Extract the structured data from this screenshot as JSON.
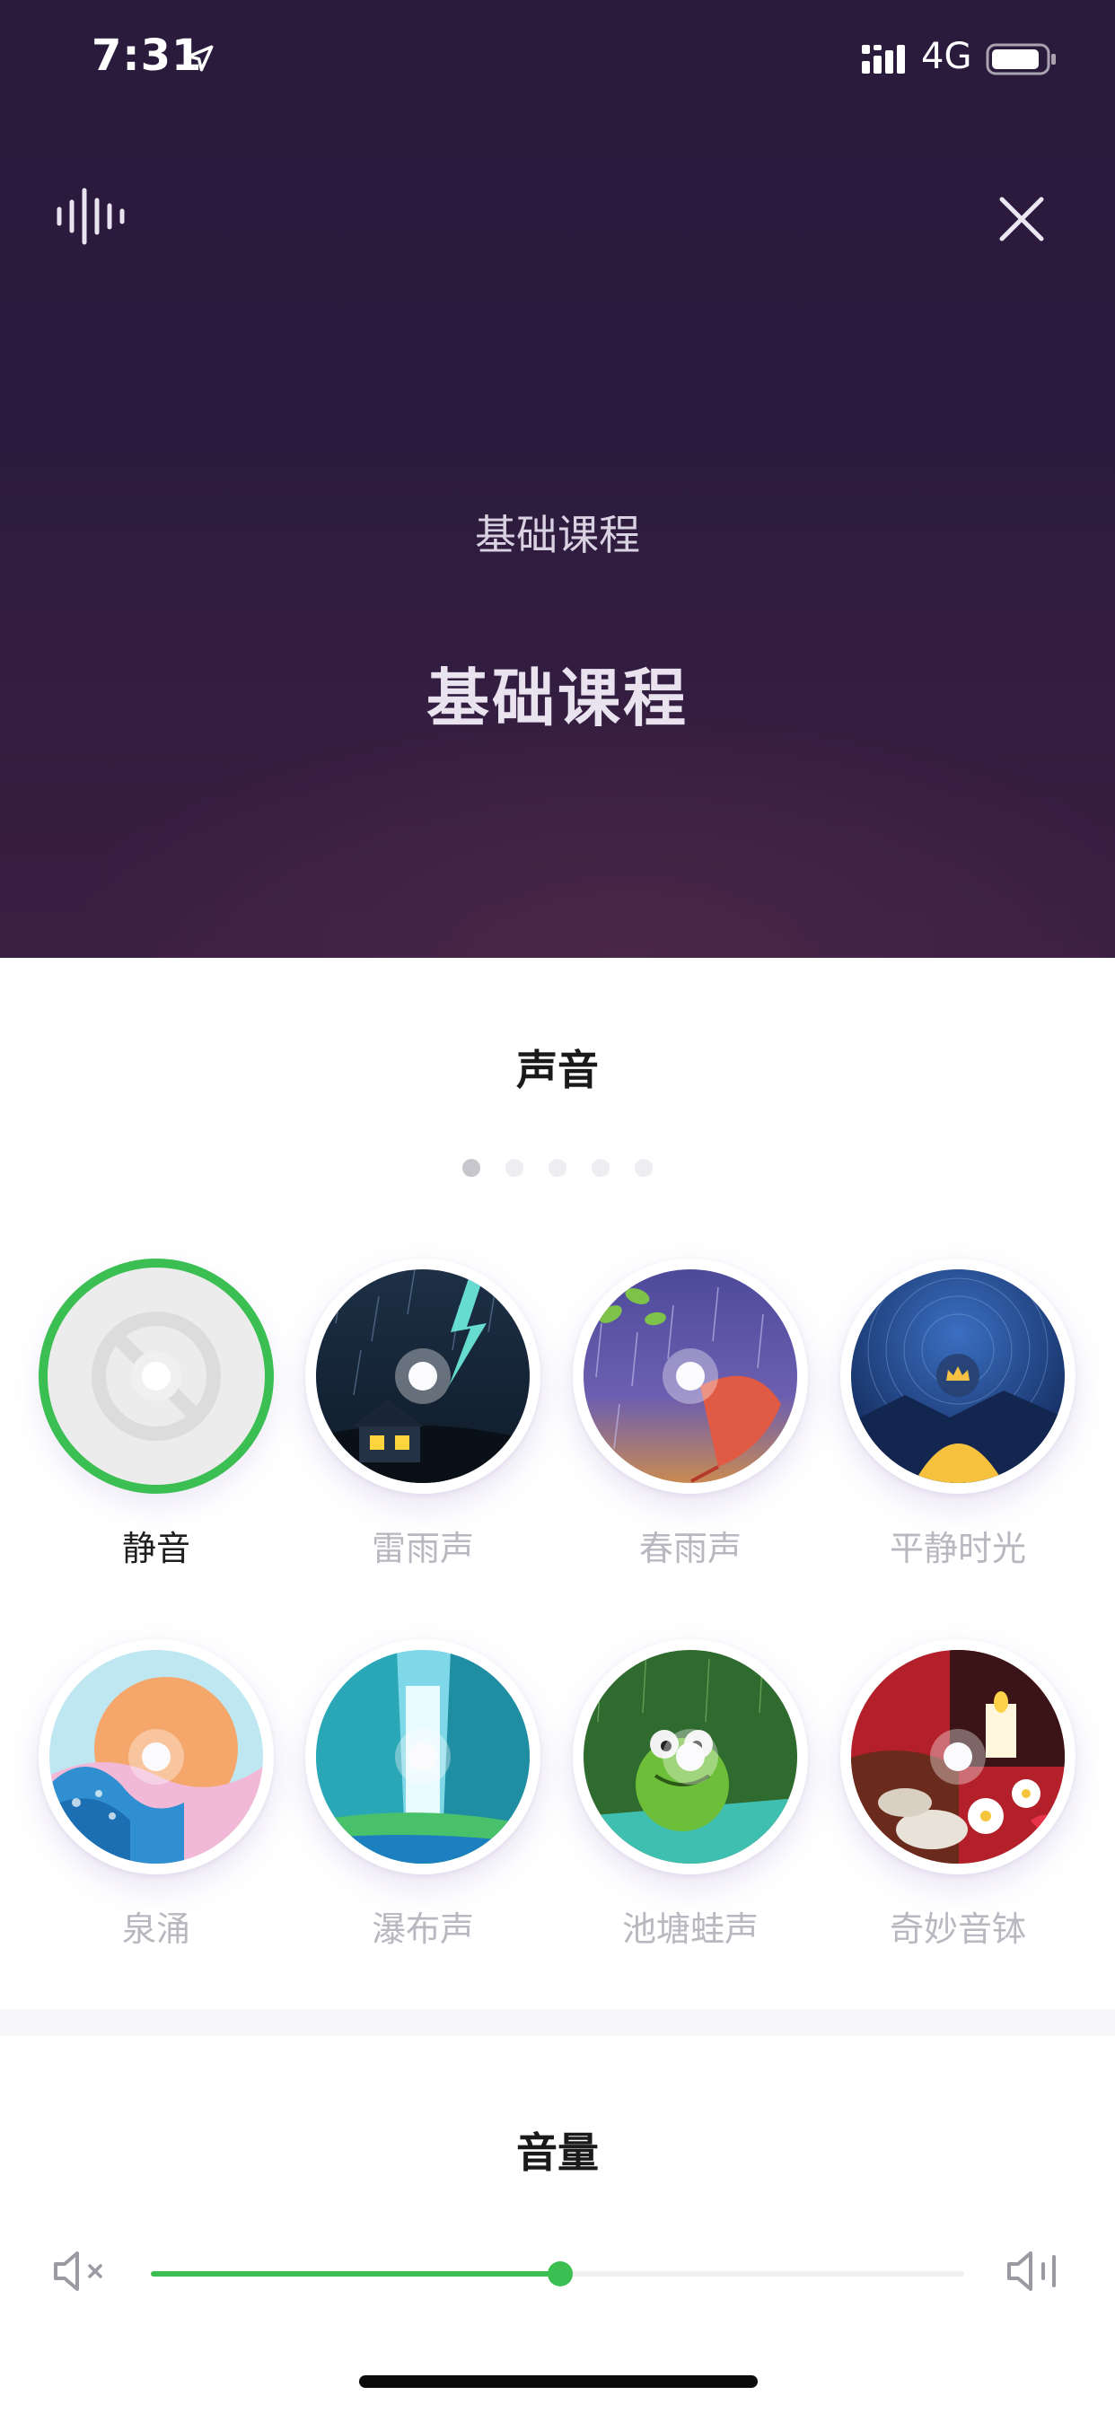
{
  "status_bar": {
    "time": "7:31",
    "network": "4G",
    "icons": [
      "location-arrow-icon",
      "cellular-signal-icon",
      "battery-icon"
    ]
  },
  "header": {
    "left_icon": "sound-wave-icon",
    "right_icon": "close-icon",
    "subtitle": "基础课程",
    "title": "基础课程"
  },
  "sounds": {
    "title": "声音",
    "page_count": 5,
    "current_page": 1,
    "items": [
      {
        "label": "静音",
        "selected": true,
        "art": "mute"
      },
      {
        "label": "雷雨声",
        "selected": false,
        "art": "thunderstorm"
      },
      {
        "label": "春雨声",
        "selected": false,
        "art": "spring-rain"
      },
      {
        "label": "平静时光",
        "selected": false,
        "art": "calm-night",
        "badge": "crown-icon"
      },
      {
        "label": "泉涌",
        "selected": false,
        "art": "spring-waves"
      },
      {
        "label": "瀑布声",
        "selected": false,
        "art": "waterfall"
      },
      {
        "label": "池塘蛙声",
        "selected": false,
        "art": "pond-frog"
      },
      {
        "label": "奇妙音钵",
        "selected": false,
        "art": "singing-bowl"
      }
    ]
  },
  "volume": {
    "title": "音量",
    "level": 0.503,
    "min_icon": "volume-mute-icon",
    "max_icon": "volume-up-icon"
  },
  "colors": {
    "accent": "#3bbf52",
    "hero_background": "#2c1b3e"
  }
}
